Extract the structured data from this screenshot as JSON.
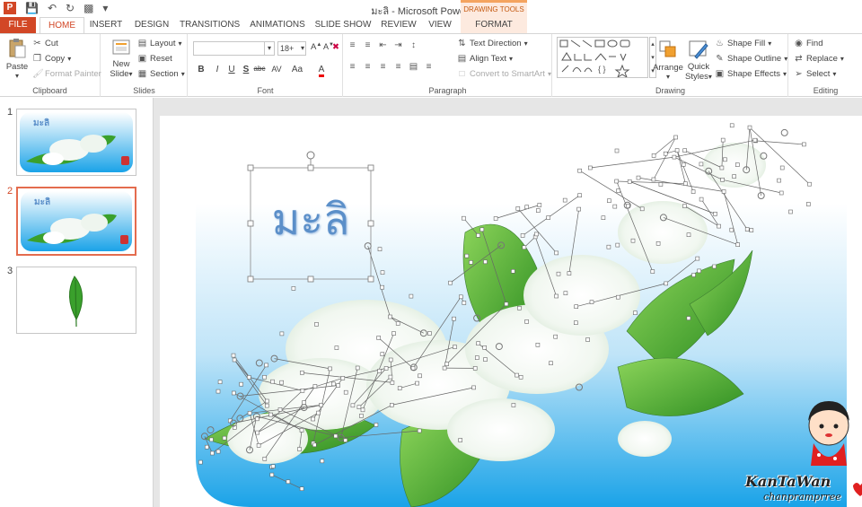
{
  "window": {
    "title": "มะลิ - Microsoft PowerPoint",
    "context_tab_group": "DRAWING TOOLS"
  },
  "tabs": [
    {
      "label": "FILE"
    },
    {
      "label": "HOME"
    },
    {
      "label": "INSERT"
    },
    {
      "label": "DESIGN"
    },
    {
      "label": "TRANSITIONS"
    },
    {
      "label": "ANIMATIONS"
    },
    {
      "label": "SLIDE SHOW"
    },
    {
      "label": "REVIEW"
    },
    {
      "label": "VIEW"
    },
    {
      "label": "FORMAT"
    }
  ],
  "ribbon": {
    "clipboard": {
      "paste": "Paste",
      "cut": "Cut",
      "copy": "Copy",
      "format_painter": "Format Painter",
      "label": "Clipboard"
    },
    "slides": {
      "new_slide": "New",
      "new_slide2": "Slide",
      "layout": "Layout",
      "reset": "Reset",
      "section": "Section",
      "label": "Slides"
    },
    "font": {
      "font_name": "",
      "font_size": "18+",
      "label": "Font"
    },
    "paragraph": {
      "text_direction": "Text Direction",
      "align_text": "Align Text",
      "convert_smartart": "Convert to SmartArt",
      "label": "Paragraph"
    },
    "drawing": {
      "arrange": "Arrange",
      "quick_styles": "Quick",
      "quick_styles2": "Styles",
      "shape_fill": "Shape Fill",
      "shape_outline": "Shape Outline",
      "shape_effects": "Shape Effects",
      "label": "Drawing"
    },
    "editing": {
      "find": "Find",
      "replace": "Replace",
      "select": "Select",
      "label": "Editing"
    }
  },
  "thumbnails": [
    {
      "number": "1",
      "title": "มะลิ"
    },
    {
      "number": "2",
      "title": "มะลิ"
    },
    {
      "number": "3",
      "title": ""
    }
  ],
  "slide": {
    "title_text": "มะลิ",
    "watermark_line1": "KanTaWan",
    "watermark_line2": "chanpramprree"
  },
  "colors": {
    "accent": "#d24726",
    "title_text": "#5b8fc9",
    "sky_top": "#ffffff",
    "sky_bottom": "#1aa3e8",
    "leaf": "#3aa02c"
  }
}
